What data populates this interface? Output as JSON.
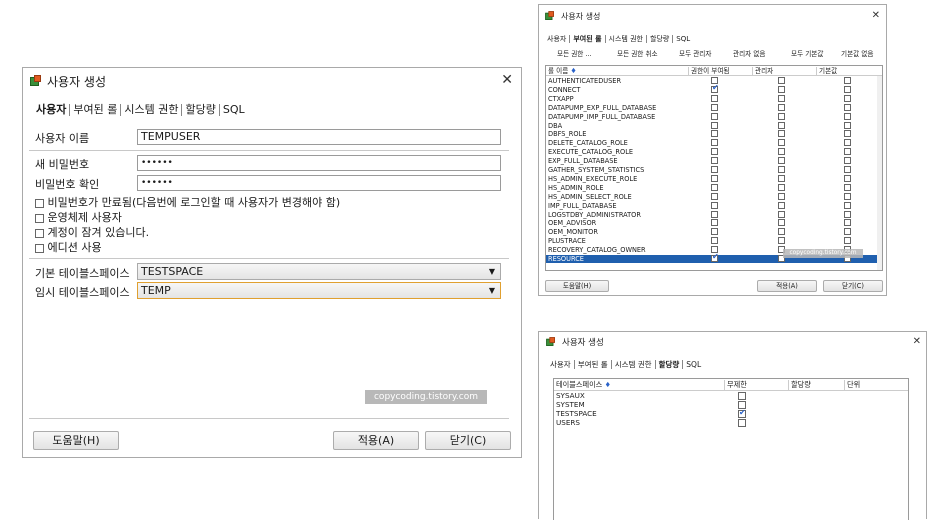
{
  "dialog_main": {
    "title": "사용자 생성",
    "tabs": [
      "사용자",
      "부여된 롤",
      "시스템 권한",
      "할당량",
      "SQL"
    ],
    "active_tab": "사용자",
    "user_name_label": "사용자 이름",
    "user_name_value": "TEMPUSER",
    "new_password_label": "새 비밀번호",
    "new_password_value": "••••••",
    "confirm_password_label": "비밀번호 확인",
    "confirm_password_value": "••••••",
    "checkboxes": [
      "비밀번호가 만료됨(다음번에 로그인할 때 사용자가 변경해야 함)",
      "운영체제 사용자",
      "계정이 잠겨 있습니다.",
      "에디션 사용"
    ],
    "default_tablespace_label": "기본 테이블스페이스",
    "default_tablespace_value": "TESTSPACE",
    "temp_tablespace_label": "임시 테이블스페이스",
    "temp_tablespace_value": "TEMP",
    "watermark": "copycoding.tistory.com",
    "help_button": "도움말(H)",
    "apply_button": "적용(A)",
    "close_button": "닫기(C)"
  },
  "dialog_roles": {
    "title": "사용자 생성",
    "tabs": [
      "사용자",
      "부여된 롤",
      "시스템 권한",
      "할당량",
      "SQL"
    ],
    "active_tab": "부여된 롤",
    "toolbar": [
      "모든 권한 ...",
      "모든 권한 취소",
      "모두 관리자",
      "관리자 없음",
      "모두 기본값",
      "기본값 없음"
    ],
    "columns": [
      "롤 이름",
      "권한이 부여됨",
      "관리자",
      "기본값"
    ],
    "rows": [
      {
        "name": "AUTHENTICATEDUSER",
        "granted": false
      },
      {
        "name": "CONNECT",
        "granted": true
      },
      {
        "name": "CTXAPP",
        "granted": false
      },
      {
        "name": "DATAPUMP_EXP_FULL_DATABASE",
        "granted": false
      },
      {
        "name": "DATAPUMP_IMP_FULL_DATABASE",
        "granted": false
      },
      {
        "name": "DBA",
        "granted": false
      },
      {
        "name": "DBFS_ROLE",
        "granted": false
      },
      {
        "name": "DELETE_CATALOG_ROLE",
        "granted": false
      },
      {
        "name": "EXECUTE_CATALOG_ROLE",
        "granted": false
      },
      {
        "name": "EXP_FULL_DATABASE",
        "granted": false
      },
      {
        "name": "GATHER_SYSTEM_STATISTICS",
        "granted": false
      },
      {
        "name": "HS_ADMIN_EXECUTE_ROLE",
        "granted": false
      },
      {
        "name": "HS_ADMIN_ROLE",
        "granted": false
      },
      {
        "name": "HS_ADMIN_SELECT_ROLE",
        "granted": false
      },
      {
        "name": "IMP_FULL_DATABASE",
        "granted": false
      },
      {
        "name": "LOGSTDBY_ADMINISTRATOR",
        "granted": false
      },
      {
        "name": "OEM_ADVISOR",
        "granted": false
      },
      {
        "name": "OEM_MONITOR",
        "granted": false
      },
      {
        "name": "PLUSTRACE",
        "granted": false
      },
      {
        "name": "RECOVERY_CATALOG_OWNER",
        "granted": false
      },
      {
        "name": "RESOURCE",
        "granted": true,
        "selected": true
      }
    ],
    "watermark": "copycoding.tistory.com",
    "help_button": "도움말(H)",
    "apply_button": "적용(A)",
    "close_button": "닫기(C)"
  },
  "dialog_quota": {
    "title": "사용자 생성",
    "tabs": [
      "사용자",
      "부여된 롤",
      "시스템 권한",
      "할당량",
      "SQL"
    ],
    "active_tab": "할당량",
    "columns": [
      "테이블스페이스",
      "무제한",
      "할당량",
      "단위"
    ],
    "rows": [
      {
        "name": "SYSAUX",
        "unlimited": false
      },
      {
        "name": "SYSTEM",
        "unlimited": false
      },
      {
        "name": "TESTSPACE",
        "unlimited": true
      },
      {
        "name": "USERS",
        "unlimited": false
      }
    ]
  }
}
